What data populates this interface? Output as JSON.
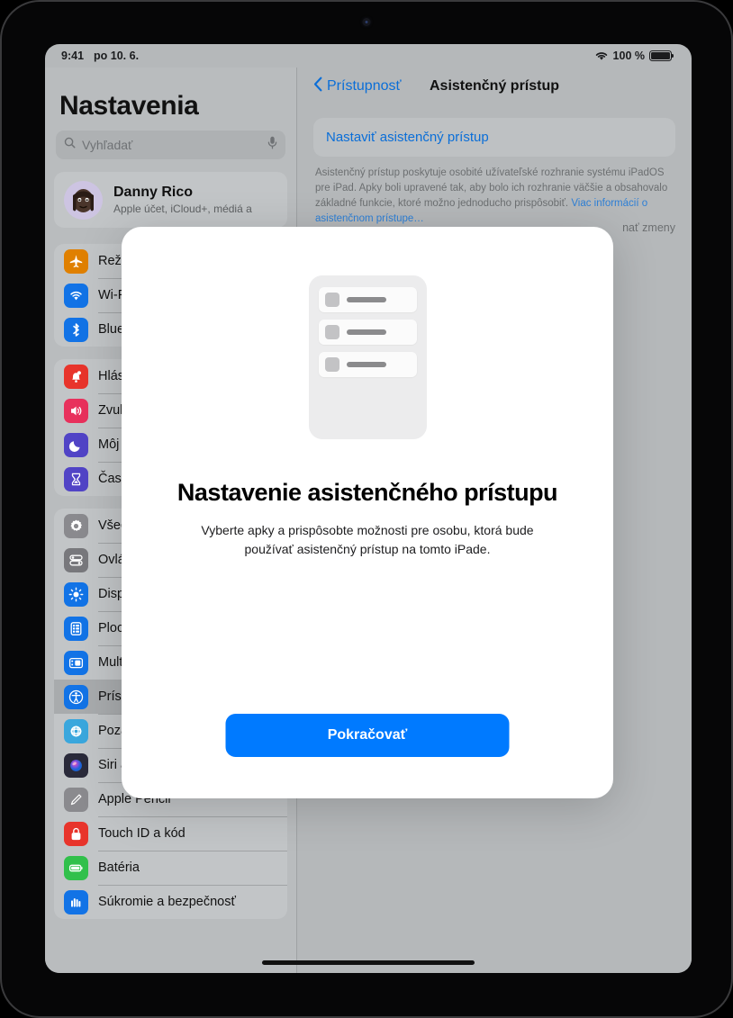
{
  "statusbar": {
    "time": "9:41",
    "date": "po 10. 6.",
    "wifi_icon": "wifi-icon",
    "battery_percent": "100 %",
    "battery_icon": "battery-full-icon"
  },
  "sidebar": {
    "title": "Nastavenia",
    "search": {
      "placeholder": "Vyhľadať",
      "value": "",
      "search_icon": "search-icon",
      "mic_icon": "microphone-icon"
    },
    "profile": {
      "name": "Danny Rico",
      "subtitle": "Apple účet, iCloud+, médiá a",
      "avatar_icon": "memoji-avatar"
    },
    "groups": [
      {
        "items": [
          {
            "label": "Režim V lietadle",
            "icon": "airplane-icon",
            "color": "#e08000"
          },
          {
            "label": "Wi-Fi",
            "icon": "wifi-icon",
            "color": "#1273e6"
          },
          {
            "label": "Bluetooth",
            "icon": "bluetooth-icon",
            "color": "#1273e6"
          }
        ]
      },
      {
        "items": [
          {
            "label": "Hlásenia",
            "icon": "bell-icon",
            "color": "#e8342b"
          },
          {
            "label": "Zvuky",
            "icon": "speaker-icon",
            "color": "#e8315c"
          },
          {
            "label": "Môj režim",
            "icon": "moon-icon",
            "color": "#5144c6"
          },
          {
            "label": "Čas pred obrazovkou",
            "icon": "hourglass-icon",
            "color": "#5144c6"
          }
        ]
      },
      {
        "items": [
          {
            "label": "Všeobecné",
            "icon": "gear-icon",
            "color": "#8a8a8e"
          },
          {
            "label": "Ovládacie centrum",
            "icon": "toggles-icon",
            "color": "#78787c"
          },
          {
            "label": "Displej a jas",
            "icon": "brightness-icon",
            "color": "#1273e6"
          },
          {
            "label": "Plocha a appka Knižnica",
            "icon": "home-screen-icon",
            "color": "#1273e6"
          },
          {
            "label": "Multitasking a gestá",
            "icon": "multitasking-icon",
            "color": "#1273e6"
          },
          {
            "label": "Prístupnosť",
            "icon": "accessibility-icon",
            "color": "#1273e6",
            "selected": true
          },
          {
            "label": "Pozadie",
            "icon": "wallpaper-icon",
            "color": "#3aa7dd"
          },
          {
            "label": "Siri a vyhľadávanie",
            "icon": "siri-icon",
            "color": "#2a2a3a"
          },
          {
            "label": "Apple Pencil",
            "icon": "pencil-icon",
            "color": "#8a8a8e"
          },
          {
            "label": "Touch ID a kód",
            "icon": "lock-icon",
            "color": "#e8342b"
          },
          {
            "label": "Batéria",
            "icon": "battery-icon",
            "color": "#31c04b"
          },
          {
            "label": "Súkromie a bezpečnosť",
            "icon": "hand-privacy-icon",
            "color": "#1273e6"
          }
        ]
      }
    ]
  },
  "detail": {
    "back_label": "Prístupnosť",
    "back_icon": "chevron-left-icon",
    "title": "Asistenčný prístup",
    "setup_link": "Nastaviť asistenčný prístup",
    "description": "Asistenčný prístup poskytuje osobité užívateľské rozhranie systému iPadOS pre iPad. Apky boli upravené tak, aby bolo ich rozhranie väčšie a obsahovalo základné funkcie, ktoré možno jednoducho prispôsobiť.",
    "description_link": "Viac informácií o asistenčnom prístupe…",
    "partial_row_text": "nať zmeny"
  },
  "modal": {
    "illustration_icon": "assistive-access-device-illustration",
    "title": "Nastavenie asistenčného prístupu",
    "subtitle": "Vyberte apky a prispôsobte možnosti pre osobu, ktorá bude používať asistenčný prístup na tomto iPade.",
    "continue_label": "Pokračovať",
    "accent_color": "#007aff"
  }
}
